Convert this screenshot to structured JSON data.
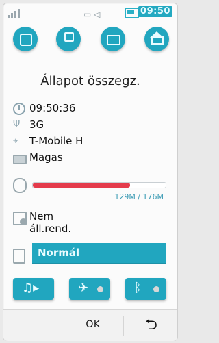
{
  "status_bar": {
    "time": "09:50",
    "icons": [
      "signal-icon",
      "network-icon",
      "volume-icon",
      "battery-icon"
    ]
  },
  "top_buttons": [
    {
      "name": "multitask-icon"
    },
    {
      "name": "phone-icon"
    },
    {
      "name": "message-icon"
    },
    {
      "name": "home-icon"
    }
  ],
  "title": "Állapot összegz.",
  "rows": {
    "time": "09:50:36",
    "network": "3G",
    "operator": "T-Mobile H",
    "battery": "Magas"
  },
  "memory": {
    "text": "129M / 176M",
    "used_fraction": 0.733
  },
  "schedule": "Nem áll.rend.",
  "profile": "Normál",
  "quick_toggles": [
    {
      "name": "music-player-icon"
    },
    {
      "name": "flight-mode-icon",
      "state": "off"
    },
    {
      "name": "bluetooth-icon",
      "state": "off"
    }
  ],
  "bottom": {
    "ok": "OK",
    "back": "back-icon"
  },
  "colors": {
    "accent": "#21a6bf",
    "memory_fill": "#e43b4b",
    "text": "#111111"
  }
}
